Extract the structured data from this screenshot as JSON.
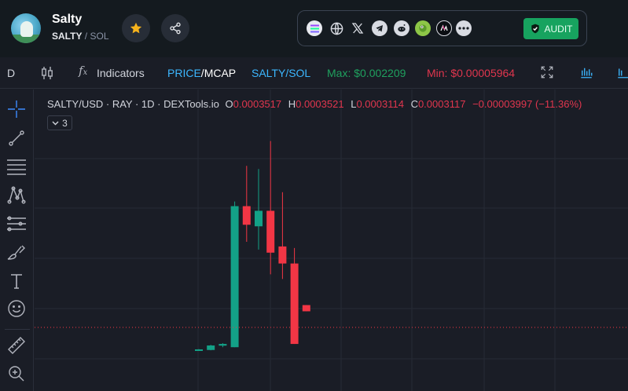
{
  "token": {
    "name": "Salty",
    "base": "SALTY",
    "separator": "/",
    "quote": "SOL"
  },
  "header": {
    "favorite_icon": "star-icon",
    "share_icon": "share-icon",
    "links": [
      {
        "name": "solana-icon",
        "color": "#9945ff"
      },
      {
        "name": "website-globe-icon",
        "color": "#d8dbe2"
      },
      {
        "name": "x-twitter-icon",
        "color": "#d8dbe2"
      },
      {
        "name": "telegram-icon",
        "color": "#d8dbe2"
      },
      {
        "name": "reddit-icon",
        "color": "#d8dbe2"
      },
      {
        "name": "coingecko-icon",
        "color": "#8dc647"
      },
      {
        "name": "coinmarketcap-icon",
        "color": "#ffffff"
      },
      {
        "name": "more-icon",
        "color": "#d8dbe2"
      }
    ],
    "audit_label": "AUDIT",
    "audit_color": "#17a35f"
  },
  "toolbar": {
    "interval": "D",
    "indicators_label": "Indicators",
    "price_label": "PRICE",
    "price_sep": "/",
    "mcap_label": "MCAP",
    "pair_label": "SALTY/SOL",
    "max_label": "Max: $0.002209",
    "min_label": "Min: $0.00005964"
  },
  "legend": {
    "title": "SALTY/USD · RAY · 1D · DEXTools.io",
    "o_label": "O",
    "o_value": "0.0003517",
    "h_label": "H",
    "h_value": "0.0003521",
    "l_label": "L",
    "l_value": "0.0003114",
    "c_label": "C",
    "c_value": "0.0003117",
    "change": "−0.00003997 (−11.36%)",
    "collapse_count": "3"
  },
  "colors": {
    "up": "#13a187",
    "down": "#f23645",
    "background": "#1a1d26",
    "grid": "#262a35"
  },
  "chart_data": {
    "type": "candlestick",
    "pair": "SALTY/USD",
    "interval": "1D",
    "candles": [
      {
        "o": 5.6e-05,
        "h": 6.8e-05,
        "l": 5.6e-05,
        "c": 6.6e-05
      },
      {
        "o": 6.2e-05,
        "h": 9.5e-05,
        "l": 6e-05,
        "c": 9.1e-05
      },
      {
        "o": 9e-05,
        "h": 0.000106,
        "l": 8e-05,
        "c": 0.000101
      },
      {
        "o": 8e-05,
        "h": 0.00102,
        "l": 8e-05,
        "c": 0.00099
      },
      {
        "o": 0.00099,
        "h": 0.00125,
        "l": 0.00076,
        "c": 0.00087
      },
      {
        "o": 0.00086,
        "h": 0.00123,
        "l": 0.00071,
        "c": 0.00096
      },
      {
        "o": 0.00096,
        "h": 0.00141,
        "l": 0.00055,
        "c": 0.00069
      },
      {
        "o": 0.00073,
        "h": 0.00108,
        "l": 0.00052,
        "c": 0.00062
      },
      {
        "o": 0.00062,
        "h": 0.00072,
        "l": 0.000101,
        "c": 0.000101
      },
      {
        "o": 0.0003517,
        "h": 0.0003521,
        "l": 0.0003114,
        "c": 0.0003117
      }
    ],
    "last_price": 0.0003117,
    "grid": true,
    "ylim": [
      0.0,
      1.54
    ]
  }
}
